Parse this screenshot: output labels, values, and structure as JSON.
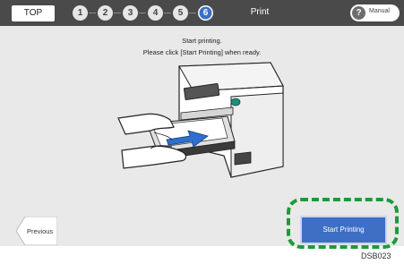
{
  "header": {
    "top_label": "TOP",
    "steps": [
      "1",
      "2",
      "3",
      "4",
      "5",
      "6"
    ],
    "active_step": "6",
    "title": "Print",
    "manual_icon": "?",
    "manual_label": "Manual"
  },
  "main": {
    "message_line1": "Start printing.",
    "message_line2": "Please click [Start Printing] when ready."
  },
  "footer": {
    "previous_label": "Previous",
    "start_label": "Start Printing"
  },
  "figure_code": "DSB023",
  "colors": {
    "header_bg": "#4a4a4a",
    "screen_bg": "#e9e9e9",
    "accent": "#3d6fc4",
    "highlight": "#1c9a3a"
  }
}
